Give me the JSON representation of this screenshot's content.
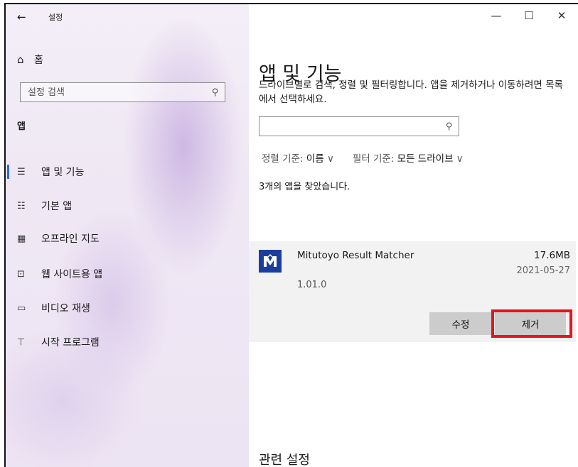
{
  "window": {
    "title": "설정",
    "controls": {
      "minimize": "—",
      "maximize": "☐",
      "close": "✕"
    }
  },
  "sidebar": {
    "back": "←",
    "home": {
      "icon": "⌂",
      "label": "홈"
    },
    "search": {
      "placeholder": "설정 검색",
      "icon": "⚲"
    },
    "section": "앱",
    "items": [
      {
        "icon": "☰",
        "label": "앱 및 기능",
        "active": true
      },
      {
        "icon": "☷",
        "label": "기본 앱"
      },
      {
        "icon": "▦",
        "label": "오프라인 지도"
      },
      {
        "icon": "⊡",
        "label": "웹 사이트용 앱"
      },
      {
        "icon": "▭",
        "label": "비디오 재생"
      },
      {
        "icon": "⊤",
        "label": "시작 프로그램"
      }
    ]
  },
  "main": {
    "title": "앱 및 기능",
    "description": "드라이브별로 검색, 정렬 및 필터링합니다. 앱을 제거하거나 이동하려면 목록에서 선택하세요.",
    "search": {
      "placeholder": "",
      "icon": "⚲"
    },
    "sort": {
      "label": "정렬 기준: ",
      "value": "이름",
      "chevron": "∨"
    },
    "filter": {
      "label": "필터 기준: ",
      "value": "모든 드라이브",
      "chevron": "∨"
    },
    "result_count": "3개의 앱을 찾았습니다.",
    "app": {
      "name": "Mitutoyo Result Matcher",
      "size": "17.6MB",
      "date": "2021-05-27",
      "version": "1.01.0",
      "modify_label": "수정",
      "remove_label": "제거"
    },
    "related_settings": "관련 설정"
  },
  "colors": {
    "accent": "#2b6cd8",
    "highlight": "#e8141b",
    "app_icon_bg": "#1d3d9e"
  }
}
